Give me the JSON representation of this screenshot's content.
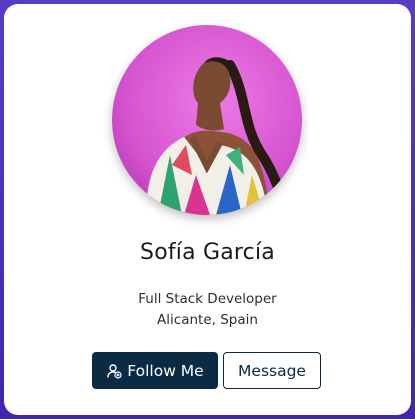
{
  "profile": {
    "name": "Sofía García",
    "role": "Full Stack Developer",
    "location": "Alicante, Spain",
    "avatar_alt": "profile photo"
  },
  "actions": {
    "follow_label": "Follow Me",
    "follow_icon": "user-plus-icon",
    "message_label": "Message"
  },
  "colors": {
    "background": "#4b2fb8",
    "card": "#ffffff",
    "primary_button": "#0b2a44",
    "photo_backdrop": "#d85bd4"
  }
}
